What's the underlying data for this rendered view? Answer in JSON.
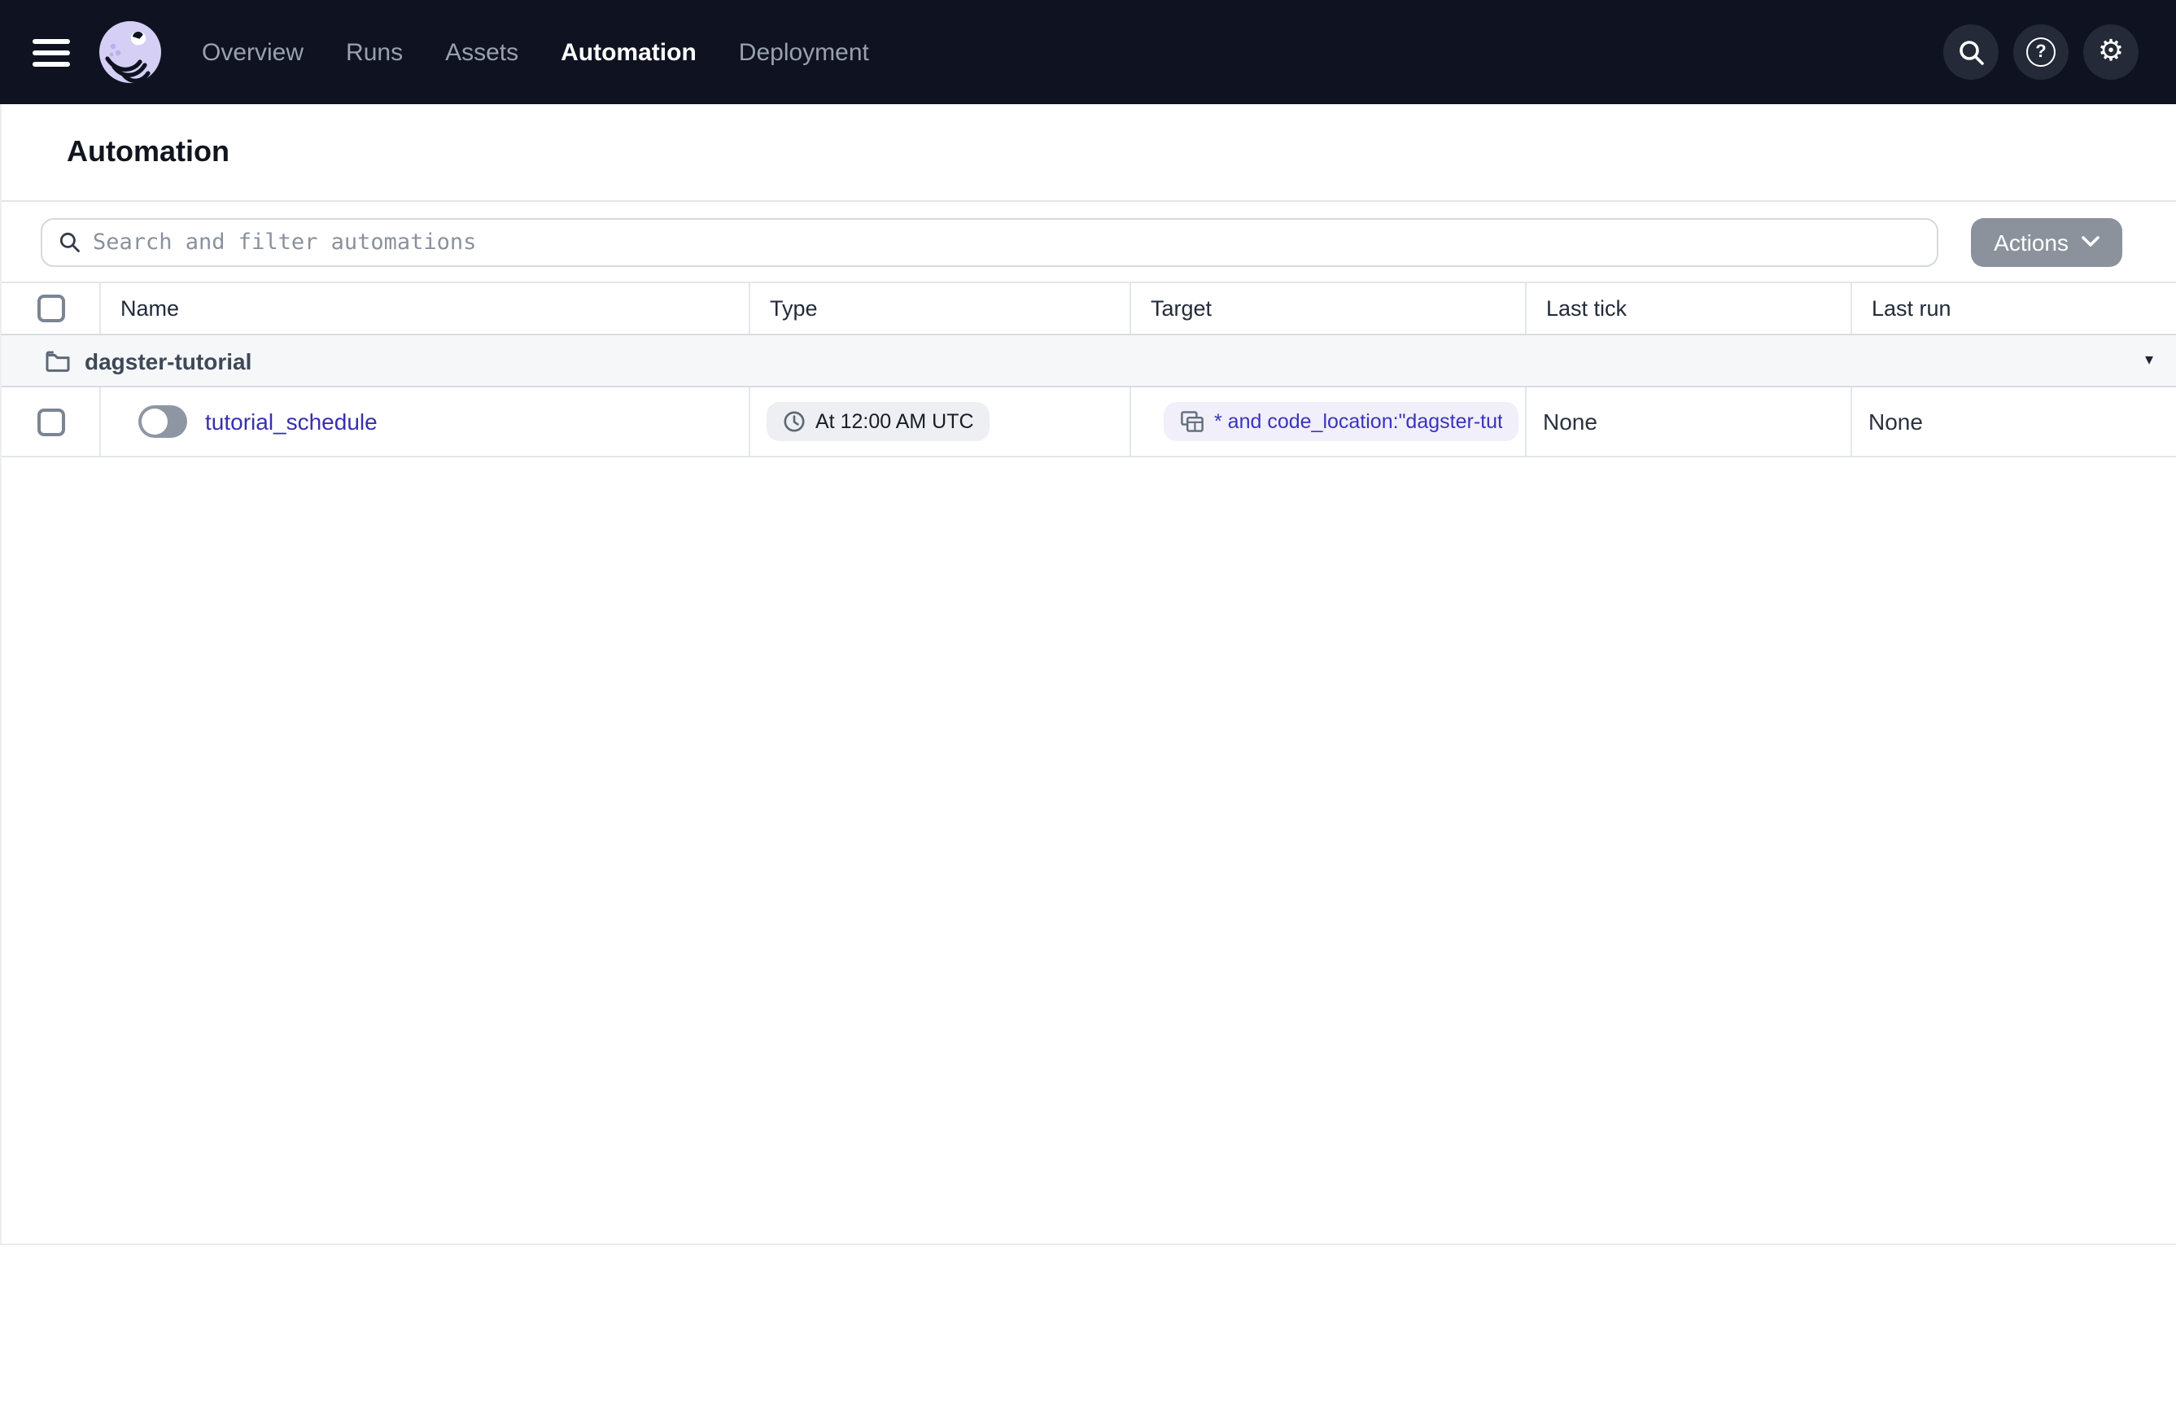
{
  "nav": {
    "items": [
      {
        "label": "Overview",
        "active": false
      },
      {
        "label": "Runs",
        "active": false
      },
      {
        "label": "Assets",
        "active": false
      },
      {
        "label": "Automation",
        "active": true
      },
      {
        "label": "Deployment",
        "active": false
      }
    ],
    "right_icons": [
      "search-icon",
      "help-icon",
      "settings-icon"
    ]
  },
  "page": {
    "title": "Automation"
  },
  "toolbar": {
    "search_placeholder": "Search and filter automations",
    "search_value": "",
    "actions_label": "Actions"
  },
  "table": {
    "columns": [
      "Name",
      "Type",
      "Target",
      "Last tick",
      "Last run"
    ],
    "group": {
      "name": "dagster-tutorial",
      "expanded": true
    },
    "rows": [
      {
        "name": "tutorial_schedule",
        "enabled": false,
        "checked": false,
        "type_label": "At 12:00 AM UTC",
        "type_icon": "clock-icon",
        "target_label": "* and code_location:\"dagster-tut",
        "target_icon": "asset-tables-icon",
        "last_tick": "None",
        "last_run": "None"
      }
    ]
  },
  "icons": {
    "hamburger": "menu-icon",
    "logo": "dagster-octopus-logo",
    "group": "folder-icon",
    "group_caret": "caret-down-icon",
    "actions_caret": "chevron-down-icon"
  },
  "colors": {
    "nav_bg": "#0f1220",
    "nav_circle": "#242a38",
    "nav_link": "#99a1af",
    "nav_link_active": "#ffffff",
    "actions_bg": "#8c929c",
    "link_color": "#3830af",
    "badge_purple_text": "#3b33be",
    "badge_purple_bg": "#f0effa",
    "badge_gray_bg": "#edeff2",
    "toggle_track": "#8e96a4",
    "group_row_bg": "#f5f7f9",
    "table_border": "#e3e6ea"
  }
}
